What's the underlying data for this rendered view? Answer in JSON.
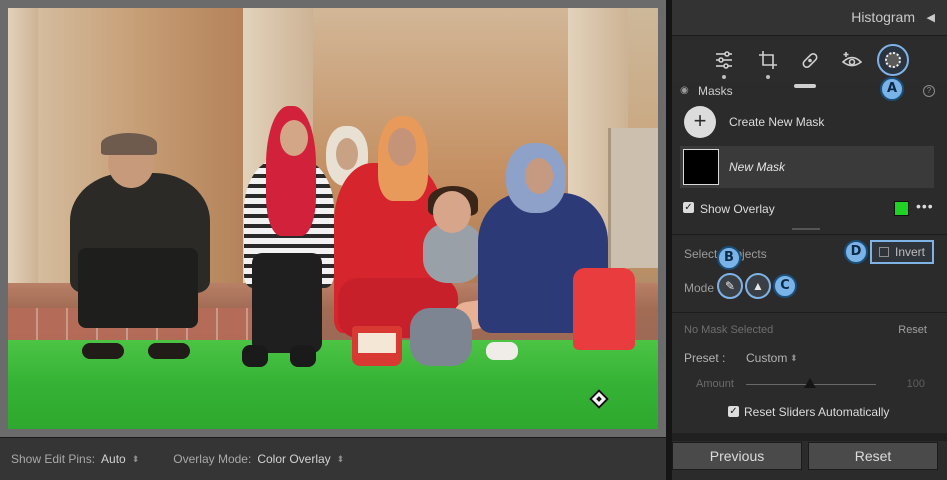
{
  "photo": {
    "description_icon": "edit-pin-icon"
  },
  "toolbar": {
    "edit_pins_label": "Show Edit Pins:",
    "edit_pins_value": "Auto",
    "overlay_mode_label": "Overlay Mode:",
    "overlay_mode_value": "Color Overlay"
  },
  "panel": {
    "histogram_title": "Histogram",
    "masks_label": "Masks",
    "create_mask_label": "Create New Mask",
    "mask_name": "New Mask",
    "show_overlay_label": "Show Overlay",
    "overlay_color": "#1fd224",
    "select_subjects_label": "Select Subjects",
    "invert_label": "Invert",
    "mode_label": "Mode",
    "no_mask_label": "No Mask Selected",
    "reset_small_label": "Reset",
    "preset_label": "Preset :",
    "preset_value": "Custom",
    "amount_label": "Amount",
    "amount_value": "100",
    "reset_sliders_label": "Reset Sliders Automatically",
    "previous_button": "Previous",
    "reset_button": "Reset"
  },
  "callouts": {
    "a": "A",
    "b": "B",
    "c": "C",
    "d": "D"
  },
  "colors": {
    "accent": "#7ab3e8",
    "overlay": "#1fd224"
  }
}
